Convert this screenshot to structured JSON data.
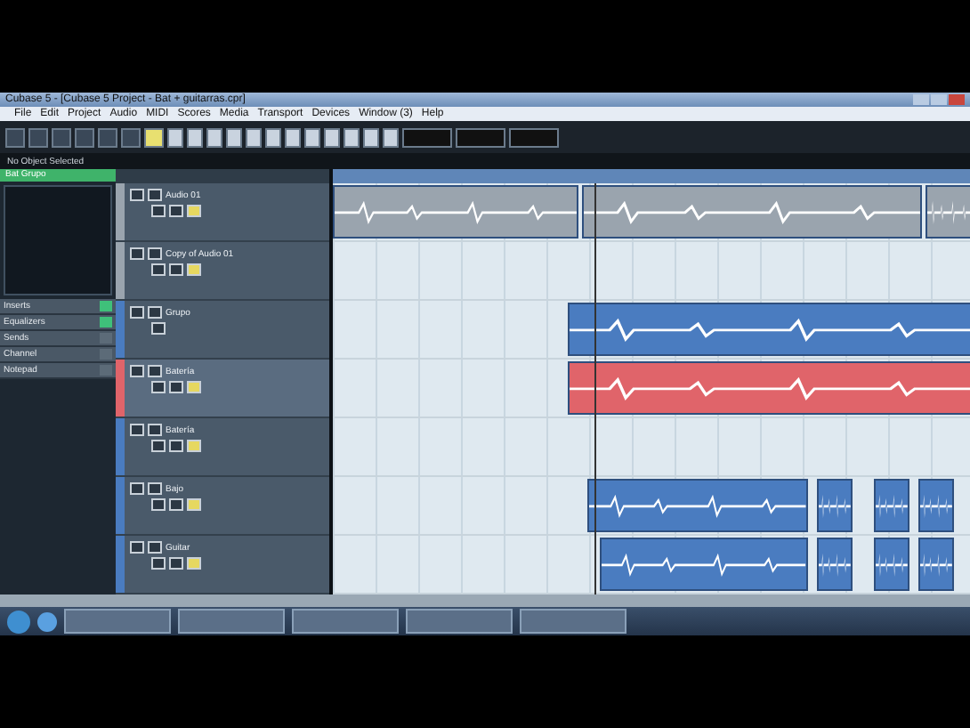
{
  "window": {
    "title": "Cubase 5 - [Cubase 5 Project - Bat + guitarras.cpr]"
  },
  "menu": [
    "File",
    "Edit",
    "Project",
    "Audio",
    "MIDI",
    "Scores",
    "Media",
    "Transport",
    "Devices",
    "Window (3)",
    "Help"
  ],
  "info_line": "No Object Selected",
  "inspector": {
    "header": "Bat Grupo",
    "sections": [
      {
        "label": "Inserts",
        "active": true
      },
      {
        "label": "Equalizers",
        "active": true
      },
      {
        "label": "Sends",
        "active": false
      },
      {
        "label": "Channel",
        "active": false
      },
      {
        "label": "Notepad",
        "active": false
      }
    ]
  },
  "tracks": [
    {
      "name": "Audio 01",
      "kind": "audio",
      "selected": false,
      "color": "#9aa4ae"
    },
    {
      "name": "Copy of Audio 01",
      "kind": "audio",
      "selected": false,
      "color": "#9aa4ae"
    },
    {
      "name": "Grupo",
      "kind": "folder",
      "selected": false,
      "color": "#4a7cc0"
    },
    {
      "name": "Batería",
      "kind": "audio",
      "selected": true,
      "color": "#e0646a"
    },
    {
      "name": "Batería",
      "kind": "audio",
      "selected": false,
      "color": "#4a7cc0"
    },
    {
      "name": "Bajo",
      "kind": "audio",
      "selected": false,
      "color": "#4a7cc0"
    },
    {
      "name": "Guitar",
      "kind": "audio",
      "selected": false,
      "color": "#4a7cc0"
    }
  ],
  "taskbar": [
    {
      "kind": "start"
    },
    {
      "kind": "browser"
    },
    {
      "kind": "app"
    },
    {
      "kind": "app"
    },
    {
      "kind": "app"
    },
    {
      "kind": "app"
    },
    {
      "kind": "app"
    }
  ]
}
